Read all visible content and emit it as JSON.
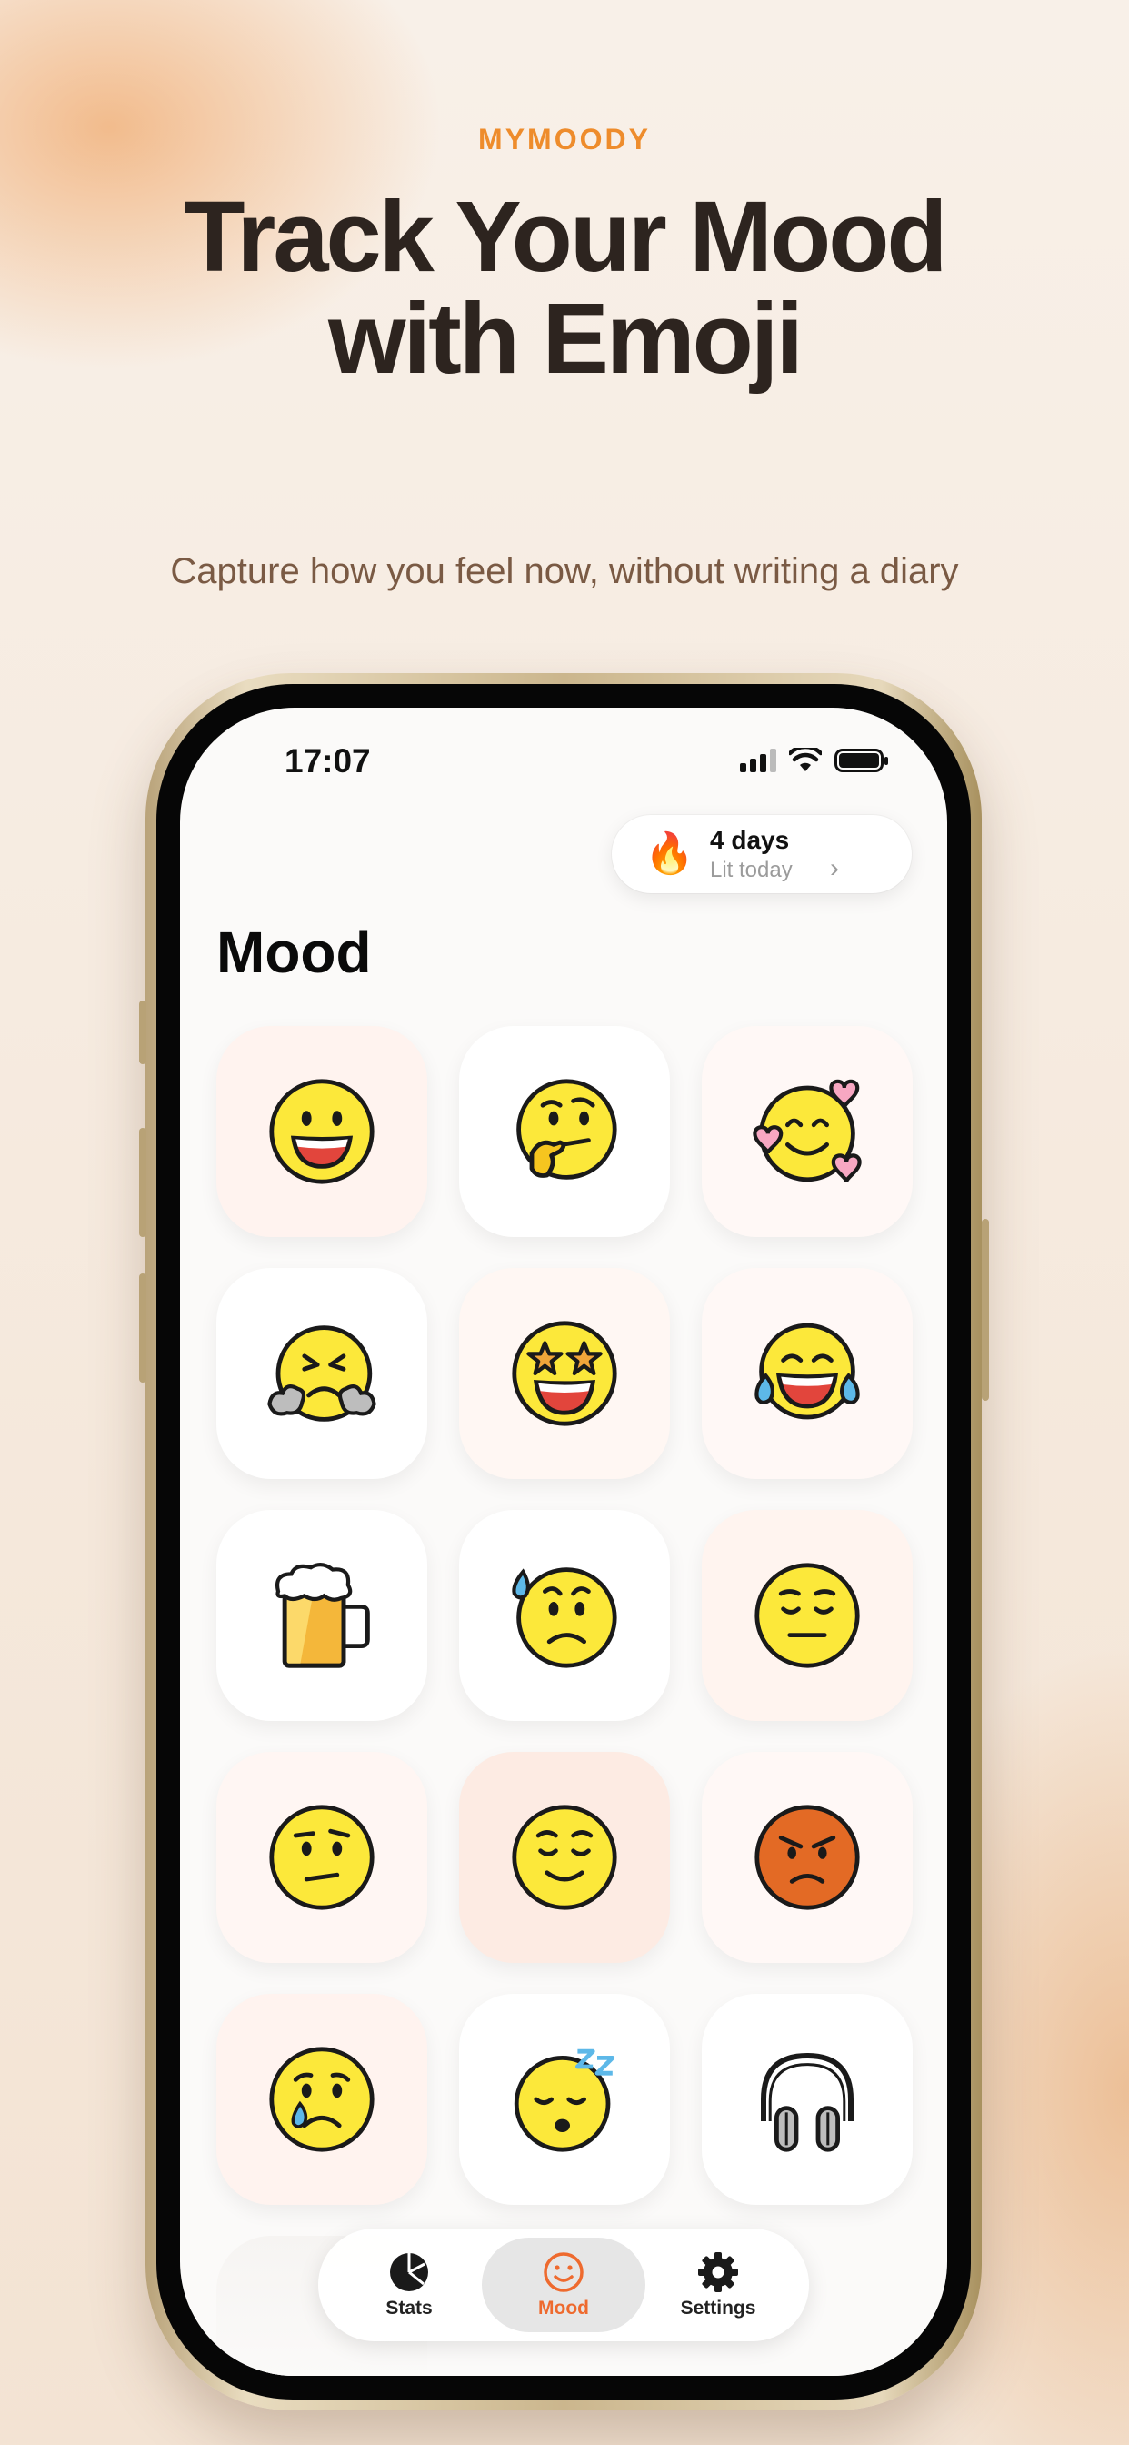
{
  "brand": "MYMOODY",
  "headline_line1": "Track Your Mood",
  "headline_line2": "with Emoji",
  "subline": "Capture how you feel now, without writing a diary",
  "status_bar": {
    "time": "17:07"
  },
  "streak": {
    "icon": "fire-icon",
    "days": "4 days",
    "subtitle": "Lit today",
    "chevron": "›"
  },
  "page_title": "Mood",
  "moods": [
    {
      "icon": "grinning-face-icon",
      "tint": "#fff3ef"
    },
    {
      "icon": "thinking-face-icon",
      "tint": "#ffffff"
    },
    {
      "icon": "smiling-face-with-hearts-icon",
      "tint": "#fff8f6"
    },
    {
      "icon": "face-with-steam-icon",
      "tint": "#ffffff"
    },
    {
      "icon": "star-struck-face-icon",
      "tint": "#fff7f3"
    },
    {
      "icon": "tears-of-joy-face-icon",
      "tint": "#fff8f6"
    },
    {
      "icon": "beer-mug-icon",
      "tint": "#ffffff"
    },
    {
      "icon": "anxious-sweat-face-icon",
      "tint": "#ffffff"
    },
    {
      "icon": "relieved-face-icon",
      "tint": "#fff4ef"
    },
    {
      "icon": "confused-face-icon",
      "tint": "#fff6f3"
    },
    {
      "icon": "content-face-icon",
      "tint": "#fdebe3"
    },
    {
      "icon": "angry-face-icon",
      "tint": "#fff8f6"
    },
    {
      "icon": "crying-face-icon",
      "tint": "#fff3ef"
    },
    {
      "icon": "sleeping-face-icon",
      "tint": "#ffffff"
    },
    {
      "icon": "headphones-icon",
      "tint": "#ffffff"
    }
  ],
  "tabs": [
    {
      "label": "Stats",
      "icon": "pie-chart-icon",
      "active": false
    },
    {
      "label": "Mood",
      "icon": "smiley-icon",
      "active": true
    },
    {
      "label": "Settings",
      "icon": "gear-icon",
      "active": false
    }
  ],
  "colors": {
    "accent": "#ee8c2c",
    "active_tab": "#ee6a2e",
    "headline": "#2d241f"
  }
}
